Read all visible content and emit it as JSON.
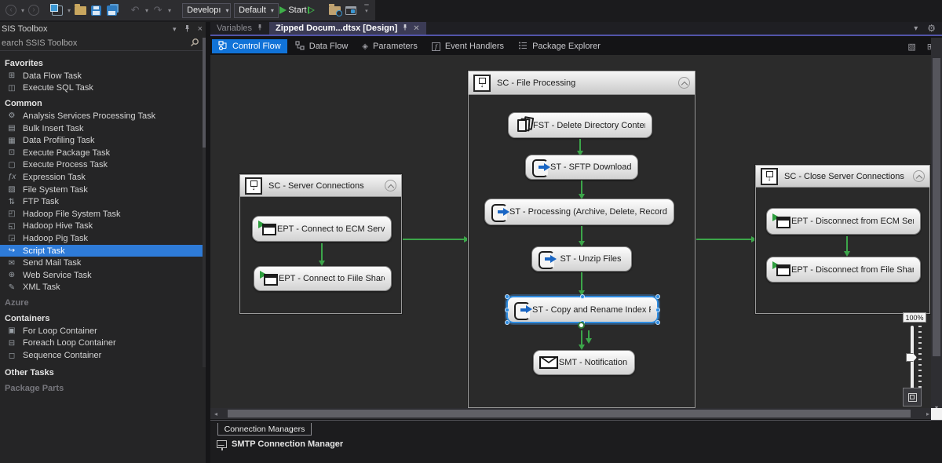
{
  "toolbar": {
    "develop_combo": "Developı",
    "config_combo": "Default",
    "start_label": "Start"
  },
  "doc_tabs": {
    "variables": "Variables",
    "document": "Zipped Docum...dtsx [Design]"
  },
  "designer_tabs": {
    "control_flow": "Control Flow",
    "data_flow": "Data Flow",
    "parameters": "Parameters",
    "event_handlers": "Event Handlers",
    "package_explorer": "Package Explorer"
  },
  "toolbox": {
    "title": "SIS Toolbox",
    "search_text": "earch SSIS Toolbox",
    "groups": [
      {
        "label": "Favorites",
        "items": [
          "Data Flow Task",
          "Execute SQL Task"
        ]
      },
      {
        "label": "Common",
        "items": [
          "Analysis Services Processing Task",
          "Bulk Insert Task",
          "Data Profiling Task",
          "Execute Package Task",
          "Execute Process Task",
          "Expression Task",
          "File System Task",
          "FTP Task",
          "Hadoop File System Task",
          "Hadoop Hive Task",
          "Hadoop Pig Task",
          "Script Task",
          "Send Mail Task",
          "Web Service Task",
          "XML Task"
        ]
      },
      {
        "label": "Azure",
        "items": []
      },
      {
        "label": "Containers",
        "items": [
          "For Loop Container",
          "Foreach Loop Container",
          "Sequence Container"
        ]
      },
      {
        "label": "Other Tasks",
        "items": []
      },
      {
        "label": "Package Parts",
        "items": []
      }
    ],
    "selected_item": "Script Task"
  },
  "canvas": {
    "containers": [
      {
        "title": "SC - Server Connections",
        "tasks": [
          "EPT - Connect to ECM Server",
          "EPT - Connect to Fiile Share"
        ]
      },
      {
        "title": "SC - File Processing",
        "tasks": [
          "FST - Delete Directory Contents",
          "ST - SFTP Download",
          "ST - Processing (Archive, Delete, Record Log)",
          "ST - Unzip Files",
          "ST - Copy and Rename Index File",
          "SMT - Notification"
        ],
        "selected_task": "ST - Copy and Rename Index File"
      },
      {
        "title": "SC - Close Server Connections",
        "tasks": [
          "EPT - Disconnect from ECM Server",
          "EPT -  Disconnect from File Share"
        ]
      }
    ],
    "arrow_color": "#3ca64a"
  },
  "zoom_control": {
    "level": "100%"
  },
  "connection_managers": {
    "tab_label": "Connection Managers",
    "items": [
      "SMTP Connection Manager"
    ]
  },
  "colors": {
    "selection_blue": "#2e7bd8",
    "control_flow_tab_blue": "#1173d8",
    "tab_underline": "#5254a8"
  }
}
